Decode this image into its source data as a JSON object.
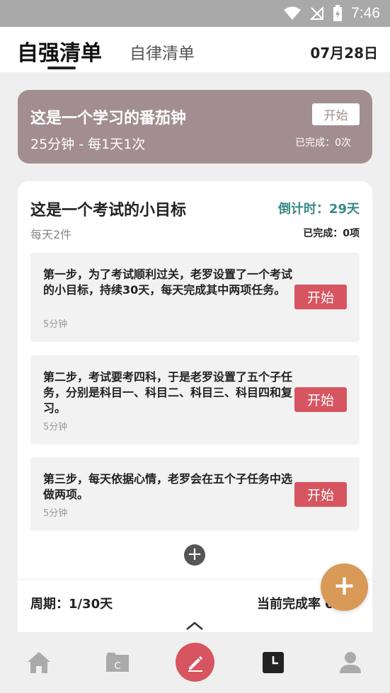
{
  "status": {
    "time": "7:46"
  },
  "header": {
    "tab_active": "自强清单",
    "tab_inactive": "自律清单",
    "date": "07月28日"
  },
  "pomodoro": {
    "title": "这是一个学习的番茄钟",
    "subtitle": "25分钟 - 每1天1次",
    "start_label": "开始",
    "completed": "已完成：0次"
  },
  "goal": {
    "title": "这是一个考试的小目标",
    "countdown": "倒计时：29天",
    "frequency": "每天2件",
    "completed": "已完成：0项",
    "tasks": [
      {
        "text": "第一步，为了考试顺利过关，老罗设置了一个考试的小目标，持续30天，每天完成其中两项任务。",
        "duration": "5分钟",
        "start_label": "开始"
      },
      {
        "text": "第二步，考试要考四科，于是老罗设置了五个子任务，分别是科目一、科目二、科目三、科目四和复习。",
        "duration": "5分钟",
        "start_label": "开始"
      },
      {
        "text": "第三步，每天依据心情，老罗会在五个子任务中选做两项。",
        "duration": "5分钟",
        "start_label": "开始"
      }
    ],
    "cycle": "周期：1/30天",
    "rate": "当前完成率 0%"
  },
  "nav": {
    "items": [
      "home-icon",
      "folder-icon",
      "edit-icon",
      "clock-icon",
      "profile-icon"
    ]
  },
  "colors": {
    "pomodoro_bg": "#a28e90",
    "start_red": "#d75560",
    "countdown_teal": "#3a8a86",
    "fab_orange": "#d89a56"
  }
}
